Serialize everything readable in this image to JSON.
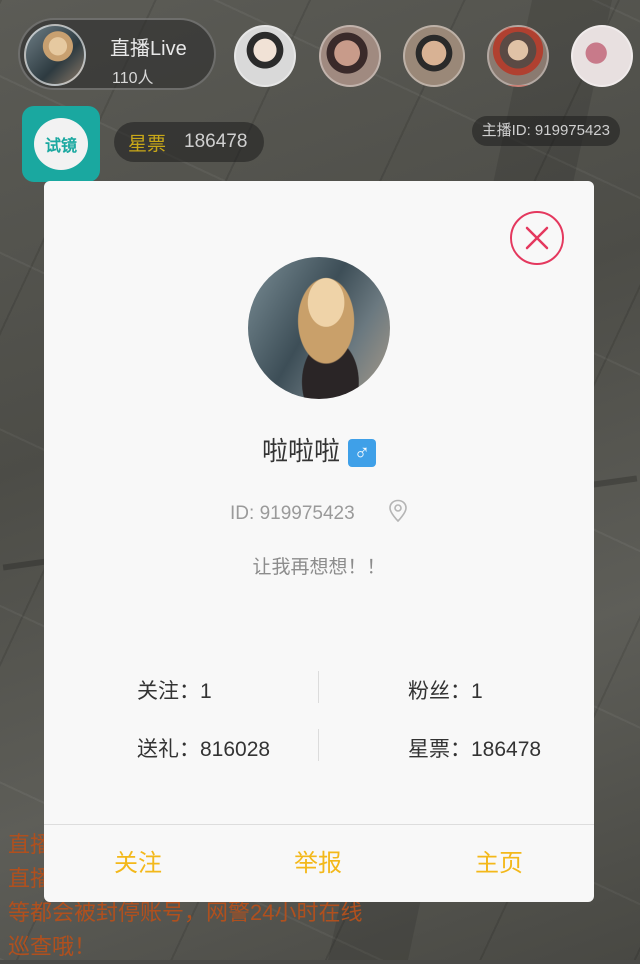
{
  "topbar": {
    "host_title": "直播Live",
    "host_count": "110人",
    "star_ticket_label": "星票",
    "star_ticket_value": "186478",
    "anchor_id": "主播ID: 919975423",
    "app_logo_text": "试镜"
  },
  "notice": {
    "line1": "直播",
    "line2": "直播",
    "line3": "等都会被封停账号，网警24小时在线",
    "line4": "巡查哦！"
  },
  "profile": {
    "name": "啦啦啦",
    "gender_symbol": "♂",
    "id_text": "ID: 919975423",
    "signature": "让我再想想！！",
    "follow_stat": "关注：1",
    "fans_stat": "粉丝：1",
    "gift_stat": "送礼：816028",
    "ticket_stat": "星票：186478"
  },
  "actions": {
    "follow": "关注",
    "report": "举报",
    "home": "主页"
  },
  "colors": {
    "accent": "#f3b81a",
    "close": "#e4385e",
    "gender": "#3fa0e8",
    "ticket_label": "#c9a818"
  }
}
